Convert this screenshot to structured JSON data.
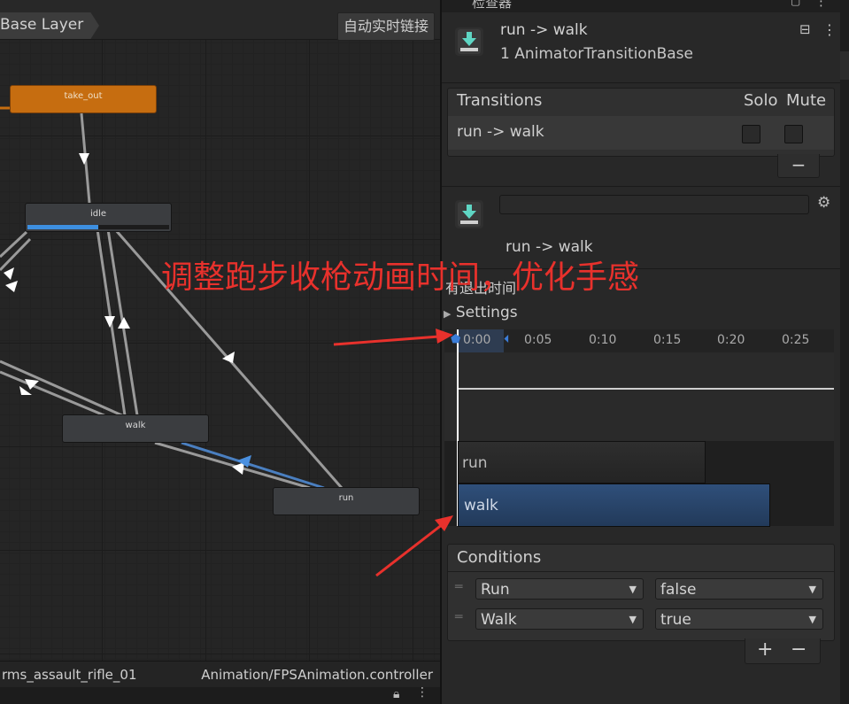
{
  "animator": {
    "layer_name": "Base Layer",
    "auto_live_link": "自动实时链接",
    "nodes": {
      "take_out": "take_out",
      "idle": "idle",
      "walk": "walk",
      "run": "run"
    },
    "idle_progress": 0.5,
    "status_left": "rms_assault_rifle_01",
    "status_right": "Animation/FPSAnimation.controller"
  },
  "inspector": {
    "tab_title": "检查器",
    "header_title": "run -> walk",
    "header_subtitle": "1 AnimatorTransitionBase",
    "transitions": {
      "title": "Transitions",
      "solo_label": "Solo",
      "mute_label": "Mute",
      "row_label": "run -> walk",
      "remove_label": "−"
    },
    "transition_name_value": "",
    "transition_label": "run -> walk",
    "has_exit_time_label": "有退出时间",
    "settings_label": "Settings",
    "timeline": {
      "ticks": [
        "0:00",
        "0:05",
        "0:10",
        "0:15",
        "0:20",
        "0:25"
      ],
      "clip_from": "run",
      "clip_to": "walk"
    },
    "conditions": {
      "title": "Conditions",
      "rows": [
        {
          "param": "Run",
          "value": "false"
        },
        {
          "param": "Walk",
          "value": "true"
        }
      ],
      "add_label": "+",
      "remove_label": "−"
    }
  },
  "annotation": {
    "text": "调整跑步收枪动画时间，优化手感",
    "color": "#e8312c"
  }
}
